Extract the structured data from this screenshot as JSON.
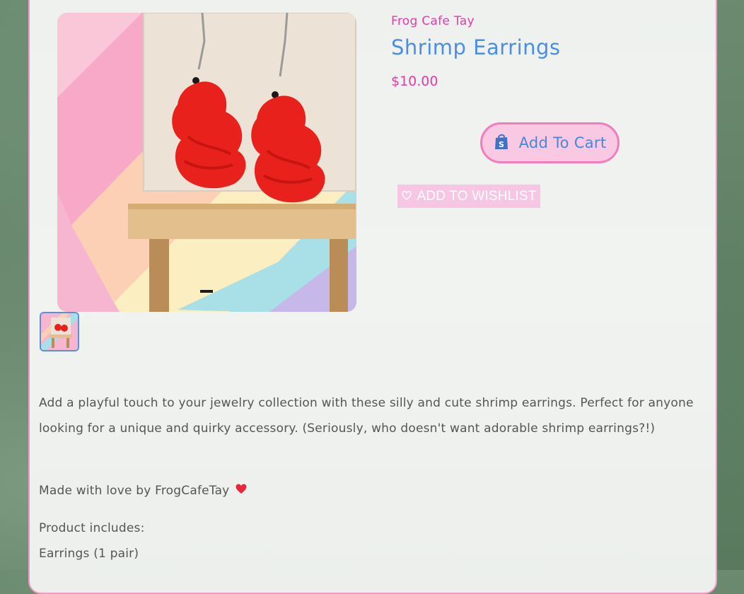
{
  "product": {
    "vendor": "Frog Cafe Tay",
    "title": "Shrimp Earrings",
    "price": "$10.00",
    "add_to_cart_label": "Add To Cart",
    "wishlist_label": "ADD TO WISHLIST",
    "description": "Add a playful touch to your jewelry collection with these silly and cute shrimp earrings. Perfect for anyone looking for a unique and quirky accessory. (Seriously, who doesn't want adorable shrimp earrings?!)",
    "made_with": "Made with love by FrogCafeTay",
    "includes_label": "Product includes:",
    "includes_items": [
      "Earrings (1 pair)"
    ]
  },
  "icons": {
    "cart": "shopify-bag-icon",
    "wishlist": "heart-outline-icon",
    "made_with": "red-heart-emoji-icon"
  },
  "colors": {
    "accent_pink": "#e63ca6",
    "title_blue": "#4a8ee6",
    "button_border": "#f27dbd",
    "button_fill": "#f9c8e3",
    "card_border": "#ef9cc4"
  }
}
